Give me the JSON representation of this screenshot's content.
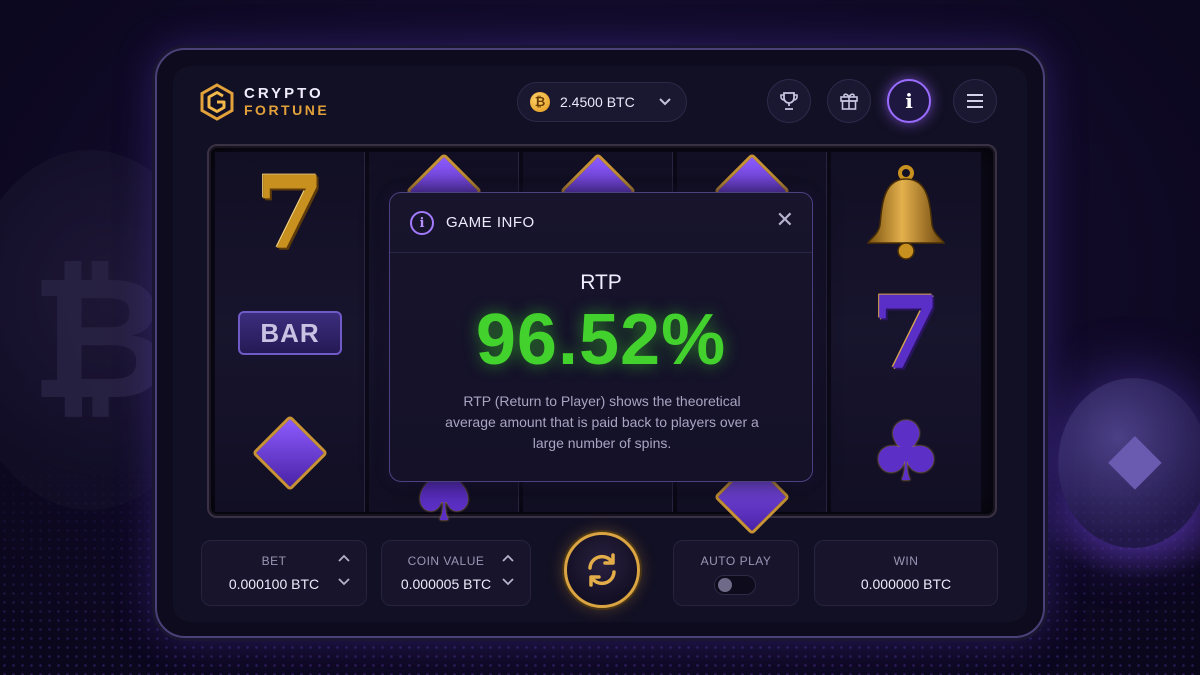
{
  "brand": {
    "name_top": "CRYPTO",
    "name_bottom": "FORTUNE"
  },
  "balance": {
    "currency_icon": "₿",
    "amount": "2.4500 BTC"
  },
  "header_buttons": [
    "trophy-icon",
    "gift-icon",
    "info-icon",
    "menu-icon"
  ],
  "reels": [
    [
      "seven-gold",
      "bar",
      "diamond"
    ],
    [
      "diamond",
      "",
      "spade"
    ],
    [
      "diamond",
      "",
      ""
    ],
    [
      "diamond",
      "",
      "diamond"
    ],
    [
      "bell",
      "seven-purple",
      "club"
    ]
  ],
  "symbols": {
    "bar_text": "BAR"
  },
  "modal": {
    "title": "GAME INFO",
    "info_glyph": "i",
    "close_glyph": "✕",
    "rtp_label": "RTP",
    "rtp_value": "96.52%",
    "description": "RTP (Return to Player) shows the theoretical average amount that is paid back to players over a large number of spins."
  },
  "controls": {
    "bet": {
      "label": "BET",
      "value": "0.000100 BTC"
    },
    "coin_value": {
      "label": "COIN VALUE",
      "value": "0.000005 BTC"
    },
    "auto_play": {
      "label": "AUTO PLAY",
      "enabled": false
    },
    "win": {
      "label": "WIN",
      "value": "0.000000 BTC"
    }
  },
  "colors": {
    "accent_purple": "#9a6cff",
    "gold": "#d9a441",
    "rtp_green": "#43d12d",
    "background": "#121024"
  }
}
